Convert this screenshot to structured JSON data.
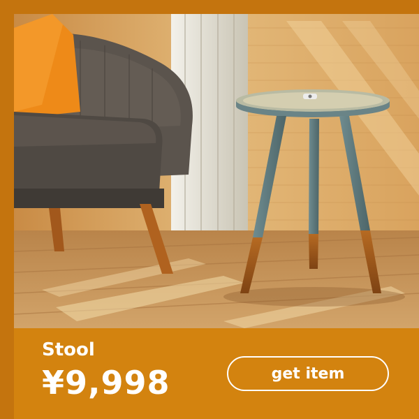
{
  "product": {
    "name": "Stool",
    "price": "¥9,998"
  },
  "cta": {
    "label": "get item"
  },
  "colors": {
    "frame": "#c4740e",
    "footer": "#d3830f",
    "text": "#ffffff"
  },
  "photo": {
    "subject": "round-top-tripod-stool-beside-armchair"
  }
}
